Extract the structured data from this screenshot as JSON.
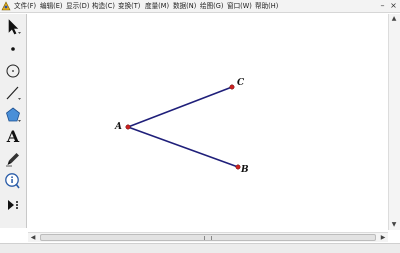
{
  "menu": {
    "items": [
      {
        "id": "file",
        "label": "文件(F)"
      },
      {
        "id": "edit",
        "label": "编辑(E)"
      },
      {
        "id": "view",
        "label": "显示(D)"
      },
      {
        "id": "construct",
        "label": "构造(C)"
      },
      {
        "id": "transform",
        "label": "变换(T)"
      },
      {
        "id": "measure",
        "label": "度量(M)"
      },
      {
        "id": "number",
        "label": "数据(N)"
      },
      {
        "id": "graph",
        "label": "绘图(G)"
      },
      {
        "id": "window",
        "label": "窗口(W)"
      },
      {
        "id": "help",
        "label": "帮助(H)"
      }
    ],
    "minimize_glyph": "–",
    "close_glyph": "×"
  },
  "toolbox": {
    "tools": [
      {
        "id": "arrow",
        "icon": "select-arrow-icon",
        "selected": true
      },
      {
        "id": "point",
        "icon": "point-tool-icon"
      },
      {
        "id": "compass",
        "icon": "compass-circle-icon"
      },
      {
        "id": "straightedge",
        "icon": "straightedge-line-icon"
      },
      {
        "id": "polygon",
        "icon": "polygon-pentagon-icon"
      },
      {
        "id": "text",
        "icon": "text-a-icon",
        "glyph": "A"
      },
      {
        "id": "marker",
        "icon": "marker-pen-icon"
      },
      {
        "id": "info",
        "icon": "information-icon",
        "glyph": "i"
      },
      {
        "id": "custom",
        "icon": "custom-tool-icon"
      }
    ]
  },
  "figure": {
    "points": [
      {
        "id": "A",
        "label": "A",
        "color": "#cc2222"
      },
      {
        "id": "B",
        "label": "B",
        "color": "#cc2222"
      },
      {
        "id": "C",
        "label": "C",
        "color": "#cc2222"
      }
    ],
    "segments": [
      {
        "from": "A",
        "to": "C",
        "color": "#1f1f7a"
      },
      {
        "from": "A",
        "to": "B",
        "color": "#1f1f7a"
      }
    ]
  },
  "scrollbars": {
    "up_glyph": "▲",
    "down_glyph": "▼",
    "left_glyph": "◀",
    "right_glyph": "▶"
  }
}
